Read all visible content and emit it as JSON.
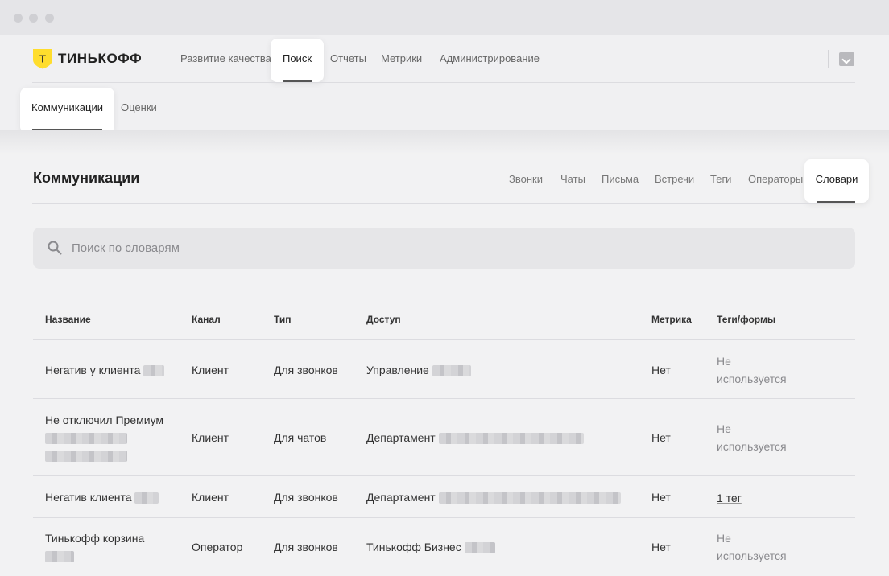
{
  "brand": {
    "logo_letter": "Т",
    "name": "ТИНЬКОФФ"
  },
  "topnav": {
    "items": [
      {
        "label": "Развитие качества"
      },
      {
        "label": "Поиск"
      },
      {
        "label": "Отчеты"
      },
      {
        "label": "Метрики"
      },
      {
        "label": "Администрирование"
      }
    ],
    "active": "Поиск"
  },
  "subnav": {
    "items": [
      {
        "label": "Коммуникации"
      },
      {
        "label": "Оценки"
      }
    ],
    "active": "Коммуникации"
  },
  "page": {
    "title": "Коммуникации",
    "tabs": [
      {
        "label": "Звонки"
      },
      {
        "label": "Чаты"
      },
      {
        "label": "Письма"
      },
      {
        "label": "Встречи"
      },
      {
        "label": "Теги"
      },
      {
        "label": "Операторы"
      },
      {
        "label": "Словари"
      }
    ],
    "active_tab": "Словари"
  },
  "search": {
    "placeholder": "Поиск по словарям",
    "value": ""
  },
  "table": {
    "headers": {
      "name": "Название",
      "channel": "Канал",
      "type": "Тип",
      "access": "Доступ",
      "metric": "Метрика",
      "tags": "Теги/формы"
    },
    "rows": [
      {
        "name": "Негатив у клиента",
        "channel": "Клиент",
        "type": "Для звонков",
        "access": "Управление",
        "metric": "Нет",
        "tags_line1": "Не",
        "tags_line2": "используется"
      },
      {
        "name": "Не отключил Премиум",
        "channel": "Клиент",
        "type": "Для чатов",
        "access": "Департамент",
        "metric": "Нет",
        "tags_line1": "Не",
        "tags_line2": "используется"
      },
      {
        "name": "Негатив клиента",
        "channel": "Клиент",
        "type": "Для звонков",
        "access": "Департамент",
        "metric": "Нет",
        "tags": "1 тег"
      },
      {
        "name": "Тинькофф корзина",
        "channel": "Оператор",
        "type": "Для звонков",
        "access": "Тинькофф Бизнес",
        "metric": "Нет",
        "tags_line1": "Не",
        "tags_line2": "используется"
      }
    ]
  },
  "colors": {
    "brand_yellow": "#ffdd2d",
    "active_underline": "#555555"
  }
}
